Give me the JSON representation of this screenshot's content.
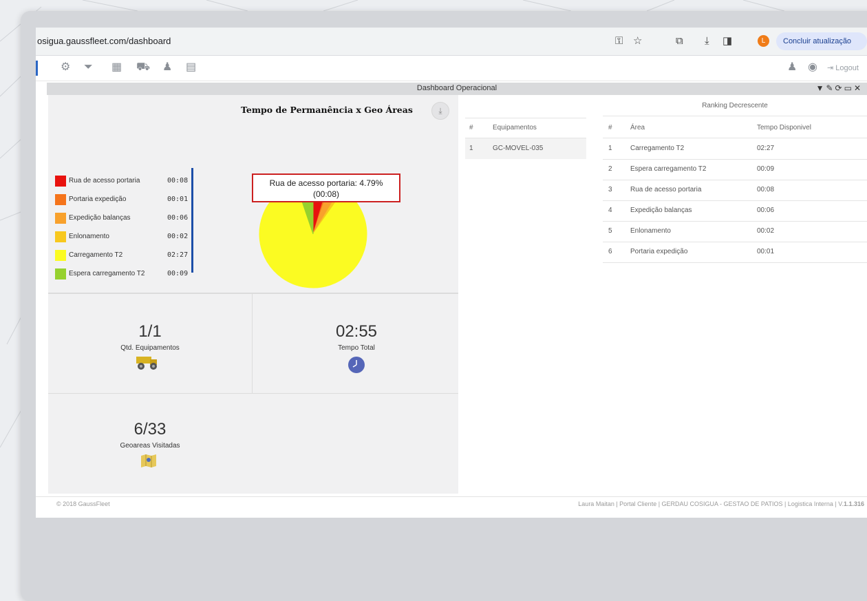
{
  "browser": {
    "url": "osigua.gaussfleet.com/dashboard",
    "update_button": "Concluir atualização",
    "profile_initial": "L"
  },
  "toolbar": {
    "icons": [
      "gear-icon",
      "filter-icon",
      "calendar-icon",
      "truck-icon",
      "user-icon",
      "id-card-icon"
    ],
    "logout_label": "Logout"
  },
  "panel": {
    "title": "Dashboard Operacional"
  },
  "pie_chart": {
    "title": "Tempo de Permanência x Geo Áreas",
    "tooltip_line1": "Rua de acesso portaria: 4.79%",
    "tooltip_line2": "(00:08)"
  },
  "chart_data": {
    "type": "pie",
    "title": "Tempo de Permanência x Geo Áreas",
    "unit": "hh:mm",
    "categories": [
      "Rua de acesso portaria",
      "Portaria expedição",
      "Expedição balanças",
      "Enlonamento",
      "Carregamento T2",
      "Espera carregamento T2"
    ],
    "values": [
      8,
      1,
      6,
      2,
      147,
      9
    ],
    "labels": [
      "00:08",
      "00:01",
      "00:06",
      "00:02",
      "02:27",
      "00:09"
    ],
    "colors": [
      "#e8120e",
      "#f5741b",
      "#f8a12c",
      "#f8c81e",
      "#fbfb22",
      "#96d12e"
    ],
    "legend_position": "left",
    "highlight": "Rua de acesso portaria"
  },
  "stats": {
    "equipamentos_value": "1/1",
    "equipamentos_label": "Qtd. Equipamentos",
    "tempo_value": "02:55",
    "tempo_label": "Tempo Total",
    "geoareas_value": "6/33",
    "geoareas_label": "Geoareas Visitadas"
  },
  "equipment_table": {
    "headers": [
      "#",
      "Equipamentos"
    ],
    "rows": [
      [
        "1",
        "GC-MOVEL-035"
      ]
    ]
  },
  "ranking_table": {
    "title": "Ranking Decrescente",
    "headers": [
      "#",
      "Área",
      "Tempo Disponivel"
    ],
    "rows": [
      [
        "1",
        "Carregamento T2",
        "02:27"
      ],
      [
        "2",
        "Espera carregamento T2",
        "00:09"
      ],
      [
        "3",
        "Rua de acesso portaria",
        "00:08"
      ],
      [
        "4",
        "Expedição balanças",
        "00:06"
      ],
      [
        "5",
        "Enlonamento",
        "00:02"
      ],
      [
        "6",
        "Portaria expedição",
        "00:01"
      ]
    ]
  },
  "footer": {
    "copyright": "© 2018 GaussFleet",
    "info_text": "Laura Maitan | Portal Cliente | GERDAU COSIGUA - GESTAO DE PATIOS | Logistica Interna | V.",
    "version": "1.1.316"
  }
}
